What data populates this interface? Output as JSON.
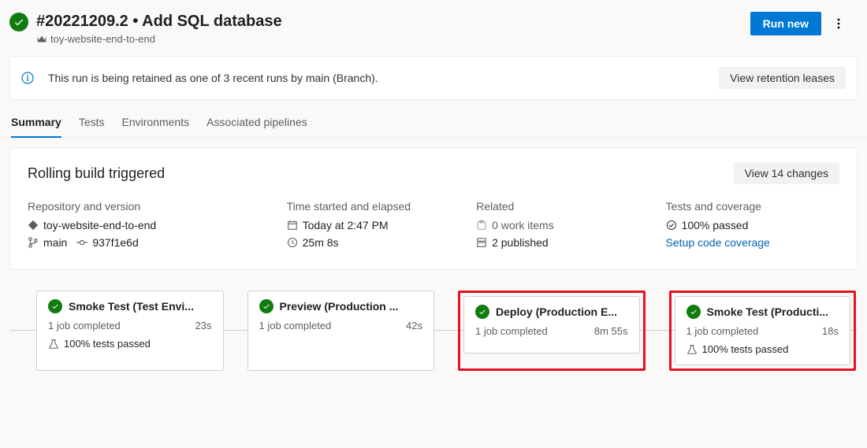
{
  "header": {
    "title": "#20221209.2 • Add SQL database",
    "pipeline_name": "toy-website-end-to-end",
    "run_new_label": "Run new"
  },
  "info_bar": {
    "text": "This run is being retained as one of 3 recent runs by main (Branch).",
    "button_label": "View retention leases"
  },
  "tabs": [
    {
      "label": "Summary",
      "active": true
    },
    {
      "label": "Tests",
      "active": false
    },
    {
      "label": "Environments",
      "active": false
    },
    {
      "label": "Associated pipelines",
      "active": false
    }
  ],
  "summary": {
    "section_title": "Rolling build triggered",
    "changes_button_label": "View 14 changes",
    "repo": {
      "label": "Repository and version",
      "repo_name": "toy-website-end-to-end",
      "branch": "main",
      "commit": "937f1e6d"
    },
    "time": {
      "label": "Time started and elapsed",
      "started": "Today at 2:47 PM",
      "elapsed": "25m 8s"
    },
    "related": {
      "label": "Related",
      "work_items": "0 work items",
      "published": "2 published"
    },
    "tests": {
      "label": "Tests and coverage",
      "passed": "100% passed",
      "coverage_link": "Setup code coverage"
    }
  },
  "stages": [
    {
      "title": "Smoke Test (Test Envi...",
      "jobs": "1 job completed",
      "duration": "23s",
      "tests": "100% tests passed",
      "highlight": false
    },
    {
      "title": "Preview (Production ...",
      "jobs": "1 job completed",
      "duration": "42s",
      "tests": null,
      "highlight": false
    },
    {
      "title": "Deploy (Production E...",
      "jobs": "1 job completed",
      "duration": "8m 55s",
      "tests": null,
      "highlight": true
    },
    {
      "title": "Smoke Test (Producti...",
      "jobs": "1 job completed",
      "duration": "18s",
      "tests": "100% tests passed",
      "highlight": true
    }
  ]
}
